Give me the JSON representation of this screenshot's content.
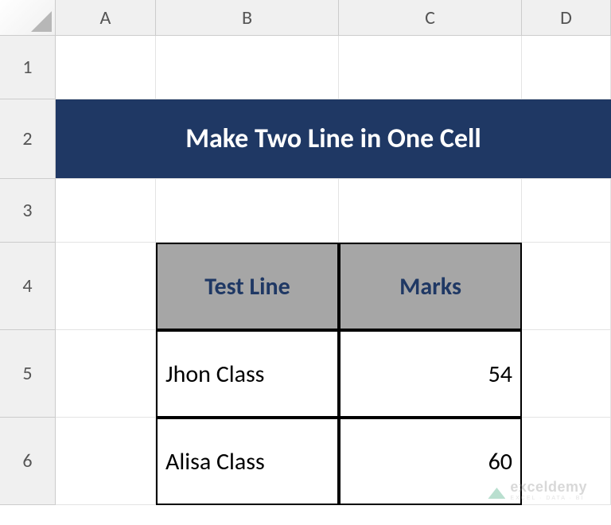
{
  "columns": [
    "A",
    "B",
    "C",
    "D"
  ],
  "rows": [
    "1",
    "2",
    "3",
    "4",
    "5",
    "6"
  ],
  "title": "Make Two Line in One Cell",
  "table": {
    "headers": {
      "col1": "Test Line",
      "col2": "Marks"
    },
    "rows": [
      {
        "name": "Jhon Class",
        "marks": "54"
      },
      {
        "name": "Alisa Class",
        "marks": "60"
      }
    ]
  },
  "watermark": {
    "main": "exceldemy",
    "sub": "EXCEL · DATA · BI"
  }
}
